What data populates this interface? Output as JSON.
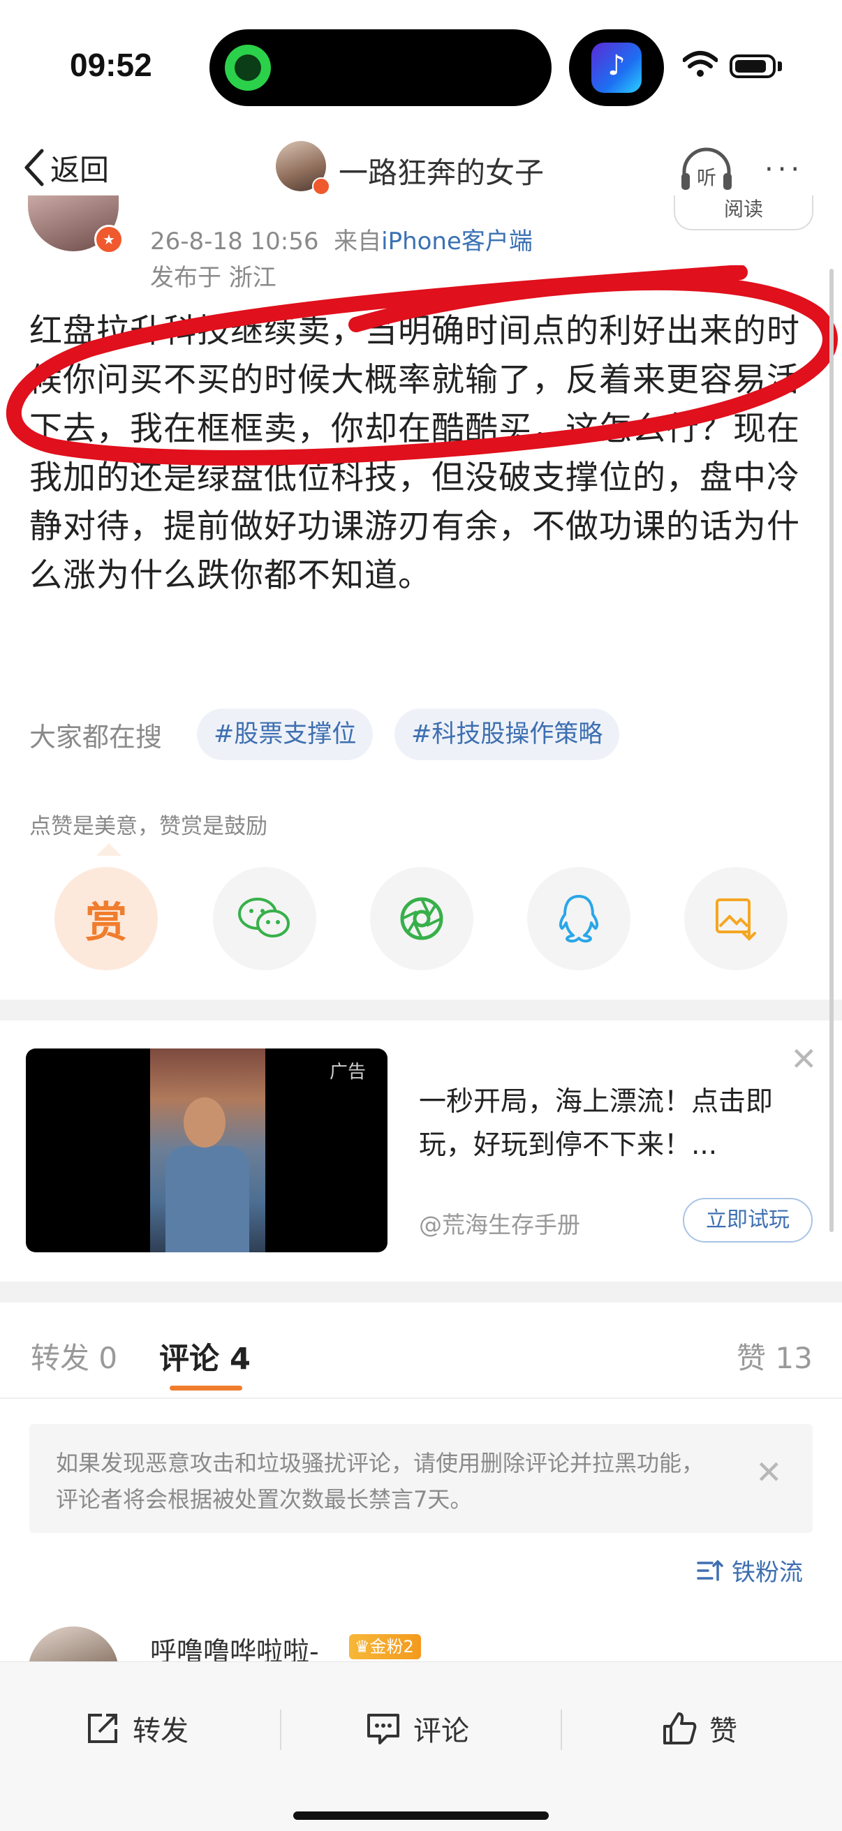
{
  "status_bar": {
    "time": "09:52"
  },
  "nav": {
    "back_label": "返回",
    "title": "一路狂奔的女子",
    "listen_label": "听",
    "more_label": "···"
  },
  "post": {
    "follow_label": "阅读",
    "meta_time": "26-8-18 10:56",
    "meta_from": "来自",
    "meta_source": "iPhone客户端",
    "location": "发布于 浙江",
    "body": "红盘拉升科技继续卖，当明确时间点的利好出来的时候你问买不买的时候大概率就输了，反着来更容易活下去，我在框框卖，你却在酷酷买，这怎么行？现在我加的还是绿盘低位科技，但没破支撑位的，盘中冷静对待，提前做好功课游刃有余，不做功课的话为什么涨为什么跌你都不知道。",
    "search_label": "大家都在搜",
    "tags": [
      "#股票支撑位",
      "#科技股操作策略"
    ],
    "reward_hint": "点赞是美意，赞赏是鼓励",
    "reward_label": "赏"
  },
  "share": {
    "icons": [
      "reward-icon",
      "wechat-icon",
      "moments-icon",
      "qq-icon",
      "save-image-icon"
    ]
  },
  "ad": {
    "label": "广告",
    "title": "一秒开局，海上漂流！点击即玩，好玩到停不下来！...",
    "source": "@荒海生存手册",
    "cta": "立即试玩"
  },
  "tabs": {
    "repost": "转发 0",
    "comment": "评论 4",
    "like": "赞 13"
  },
  "notice": {
    "text": "如果发现恶意攻击和垃圾骚扰评论，请使用删除评论并拉黑功能，评论者将会根据被处置次数最长禁言7天。"
  },
  "sort": {
    "label": "铁粉流"
  },
  "comment": {
    "user": "呼噜噜哗啦啦-",
    "badge": "金粉2"
  },
  "bottom_bar": {
    "repost": "转发",
    "comment": "评论",
    "like": "赞"
  },
  "colors": {
    "accent_orange": "#f07d2d",
    "link_blue": "#3e6fb1",
    "annotation_red": "#e0101c"
  }
}
